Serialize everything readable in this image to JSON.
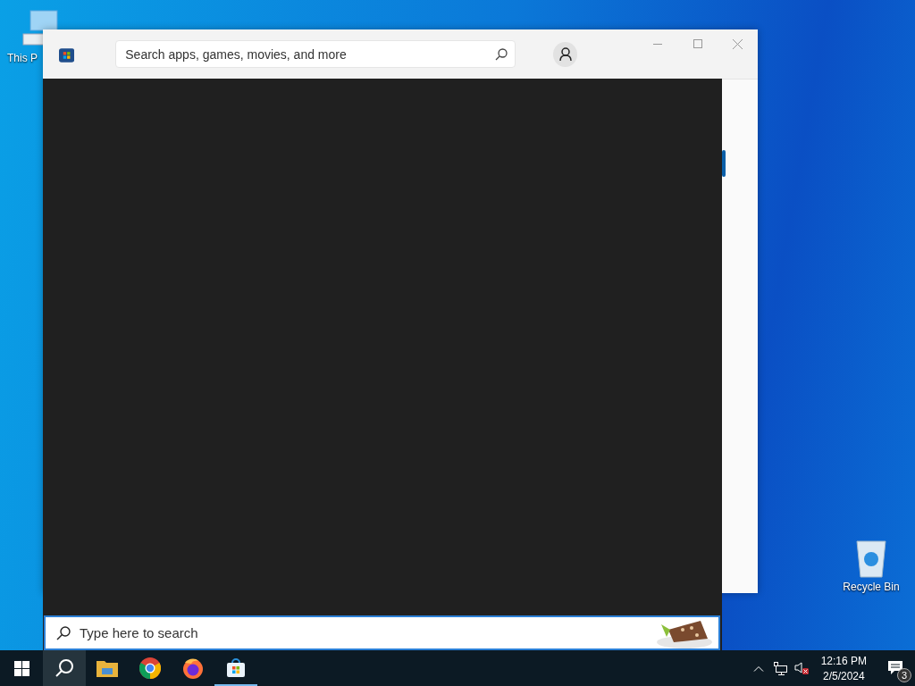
{
  "desktop_icons": [
    {
      "kind": "computer",
      "label": "This P"
    },
    {
      "kind": "recycle",
      "label": "Recycle Bin"
    }
  ],
  "store_window": {
    "search": {
      "placeholder": "Search apps, games, movies, and more"
    }
  },
  "search_panel": {
    "search": {
      "placeholder": "Type here to search"
    }
  },
  "taskbar": {
    "buttons": [
      {
        "kind": "start",
        "selected": false,
        "running": false
      },
      {
        "kind": "search",
        "selected": true,
        "running": false
      },
      {
        "kind": "explorer",
        "selected": false,
        "running": false
      },
      {
        "kind": "chrome",
        "selected": false,
        "running": false
      },
      {
        "kind": "firefox",
        "selected": false,
        "running": false
      },
      {
        "kind": "store",
        "selected": false,
        "running": true
      }
    ],
    "clock": {
      "time": "12:16 PM",
      "date": "2/5/2024"
    },
    "notifications": {
      "count": "3"
    }
  }
}
